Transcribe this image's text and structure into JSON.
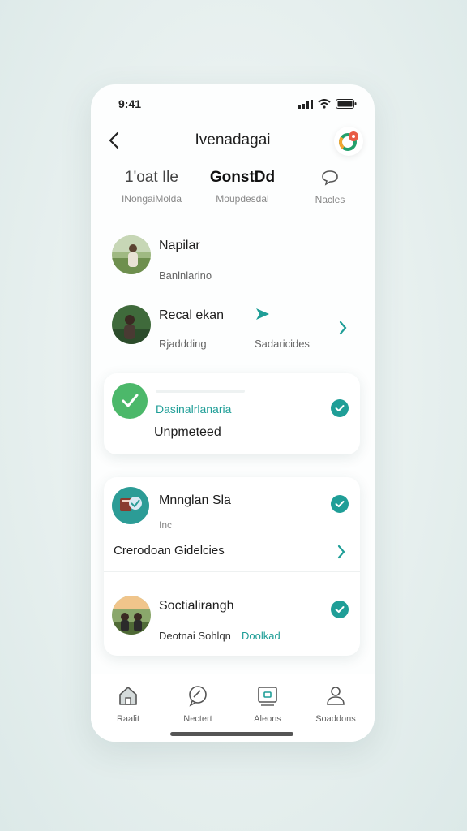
{
  "status": {
    "time": "9:41"
  },
  "header": {
    "title": "Ivenadagai"
  },
  "tabs": [
    {
      "main": "1'oat Ile",
      "sub": "INongaiMolda"
    },
    {
      "main": "GonstDd",
      "sub": "Moupdesdal"
    },
    {
      "main": "",
      "sub": "Nacles"
    }
  ],
  "list": [
    {
      "name": "Napilar",
      "sub": "Banlnlarino"
    },
    {
      "name": "Recal ekan",
      "sub": "Rjaddding",
      "extra": "Sadaricides"
    }
  ],
  "card1": {
    "link": "Dasinalrlanaria",
    "text": "Unpmeteed"
  },
  "card2": {
    "item1": {
      "name": "Mnnglan Sla",
      "sub": "Inc",
      "action": "Crerodoan Gidelcies"
    },
    "item2": {
      "name": "Soctialirangh",
      "sub": "Deotnai Sohlqn",
      "link": "Doolkad"
    }
  },
  "nav": [
    {
      "label": "Raalit",
      "icon": "home-icon"
    },
    {
      "label": "Nectert",
      "icon": "chat-icon"
    },
    {
      "label": "Aleons",
      "icon": "media-icon"
    },
    {
      "label": "Soaddons",
      "icon": "profile-icon"
    }
  ],
  "colors": {
    "accent": "#1f9e97",
    "green": "#4cb86a",
    "brand_red": "#e85b45"
  }
}
